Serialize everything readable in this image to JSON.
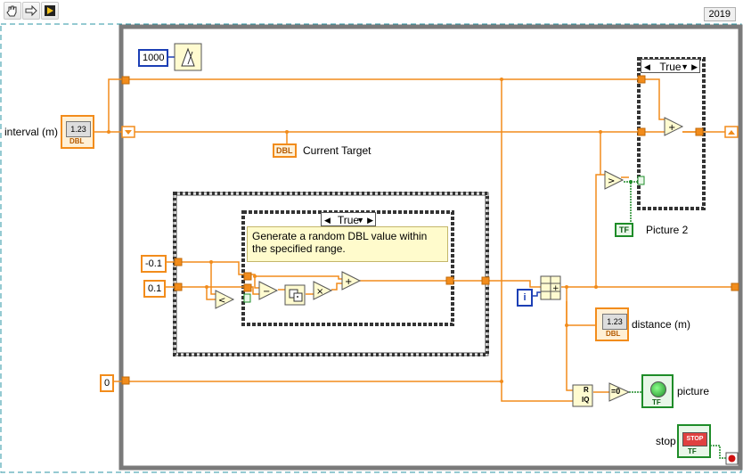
{
  "toolbar": {
    "icons": [
      "hand-tool-icon",
      "run-arrow-icon",
      "highlight-execution-icon"
    ]
  },
  "version_badge": "2019",
  "constants": {
    "wait_ms": "1000",
    "range_low": "-0.1",
    "range_high": "0.1",
    "initial_distance": "0"
  },
  "controls": {
    "interval_label": "interval (m)",
    "interval_type": "1.23",
    "interval_sub": "DBL"
  },
  "indicators": {
    "current_target_type": "DBL",
    "current_target_label": "Current Target",
    "picture2_type": "TF",
    "picture2_label": "Picture 2",
    "distance_label": "distance (m)",
    "distance_type": "1.23",
    "distance_sub": "DBL",
    "picture_label": "picture",
    "picture_sub": "TF",
    "stop_label": "stop",
    "stop_button": "STOP",
    "stop_sub": "TF"
  },
  "case_structures": {
    "outer_case_label": "True",
    "inner_case_label": "True"
  },
  "comment": "Generate a random DBL value within the specified range.",
  "loop": {
    "iteration_terminal": "i"
  },
  "nodes": {
    "quotient_remainder_r": "R",
    "quotient_remainder_iq": "IQ",
    "equals_zero": "=0"
  },
  "colors": {
    "wire_orange": "#f28c1b",
    "wire_green": "#1e8c28",
    "wire_blue": "#1c3fb5",
    "loop_border": "#7a7a7a",
    "comment_bg": "#fffbcc"
  }
}
